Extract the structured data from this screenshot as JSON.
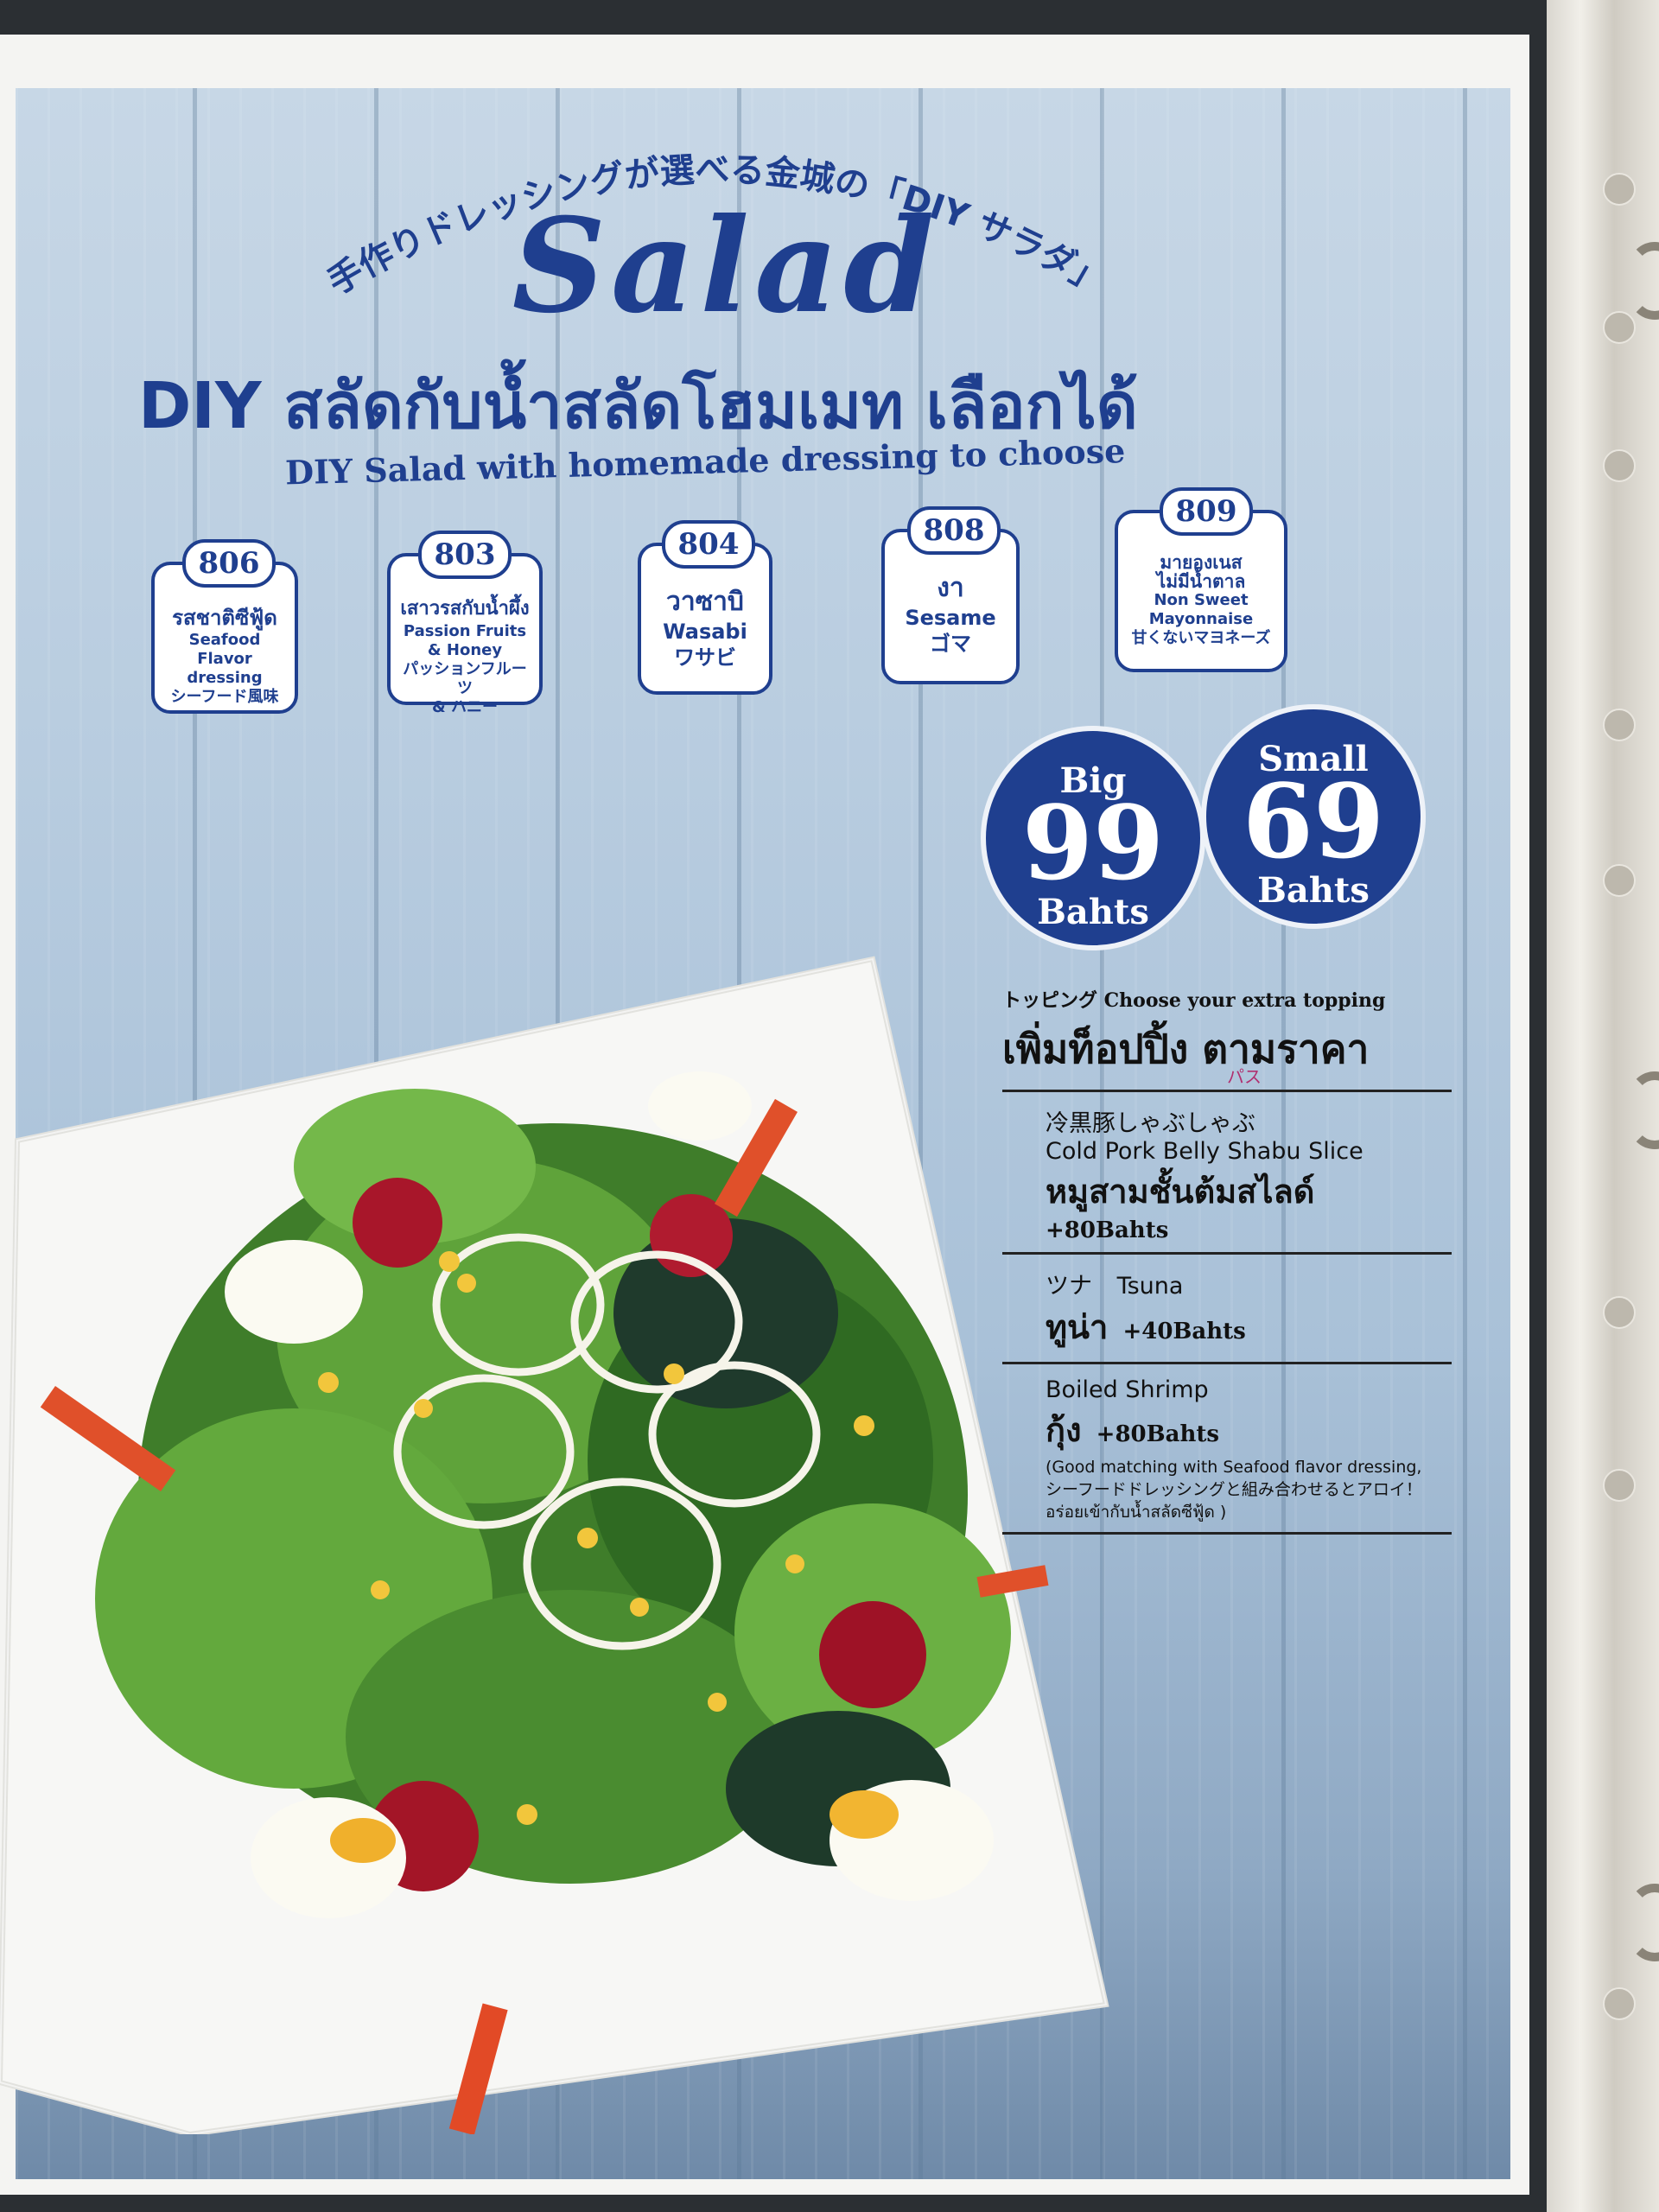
{
  "header": {
    "jp_arc": "手作りドレッシングが選べる金城の「DIY サラダ」",
    "title": "Salad",
    "thai_title": "DIY สลัดกับน้ำสลัดโฮมเมท เลือกได้",
    "en_subtitle": "DIY Salad with homemade dressing to choose"
  },
  "dressings": [
    {
      "num": "806",
      "lines": [
        "รสชาติซีฟู้ด",
        "Seafood Flavor",
        "dressing",
        "シーフード風味"
      ]
    },
    {
      "num": "803",
      "lines": [
        "เสาวรสกับน้ำผึ้ง",
        "Passion Fruits",
        "& Honey",
        "パッションフルーツ",
        "& ハニー"
      ]
    },
    {
      "num": "804",
      "lines": [
        "วาซาบิ",
        "Wasabi",
        "ワサビ"
      ]
    },
    {
      "num": "808",
      "lines": [
        "งา",
        "Sesame",
        "ゴマ"
      ]
    },
    {
      "num": "809",
      "lines": [
        "มายองเนส",
        "ไม่มีน้ำตาล",
        "Non Sweet",
        "Mayonnaise",
        "甘くないマヨネーズ"
      ]
    }
  ],
  "prices": [
    {
      "size": "Big",
      "amount": "99",
      "unit": "Bahts"
    },
    {
      "size": "Small",
      "amount": "69",
      "unit": "Bahts"
    }
  ],
  "toppings": {
    "head_small": "トッピング Choose your extra topping",
    "head_big": "เพิ่มท็อปปิ้ง ตามราคา",
    "annotation": "パス",
    "items": [
      {
        "jp": "冷黒豚しゃぶしゃぶ",
        "en": "Cold Pork Belly Shabu Slice",
        "thai": "หมูสามชั้นต้มสไลด์",
        "price": "+80Bahts"
      },
      {
        "jp": "ツナ",
        "en": "Tsuna",
        "thai": "ทูน่า",
        "price": "+40Bahts"
      },
      {
        "en": "Boiled Shrimp",
        "thai": "กุ้ง",
        "price": "+80Bahts",
        "note": [
          "(Good matching with Seafood flavor dressing,",
          "シーフードドレッシングと組み合わせるとアロイ！",
          "อร่อยเข้ากับน้ำสลัดซีฟู้ด )"
        ]
      }
    ]
  },
  "colors": {
    "navy": "#1f3f8f",
    "wood": "#a9c1d8"
  }
}
